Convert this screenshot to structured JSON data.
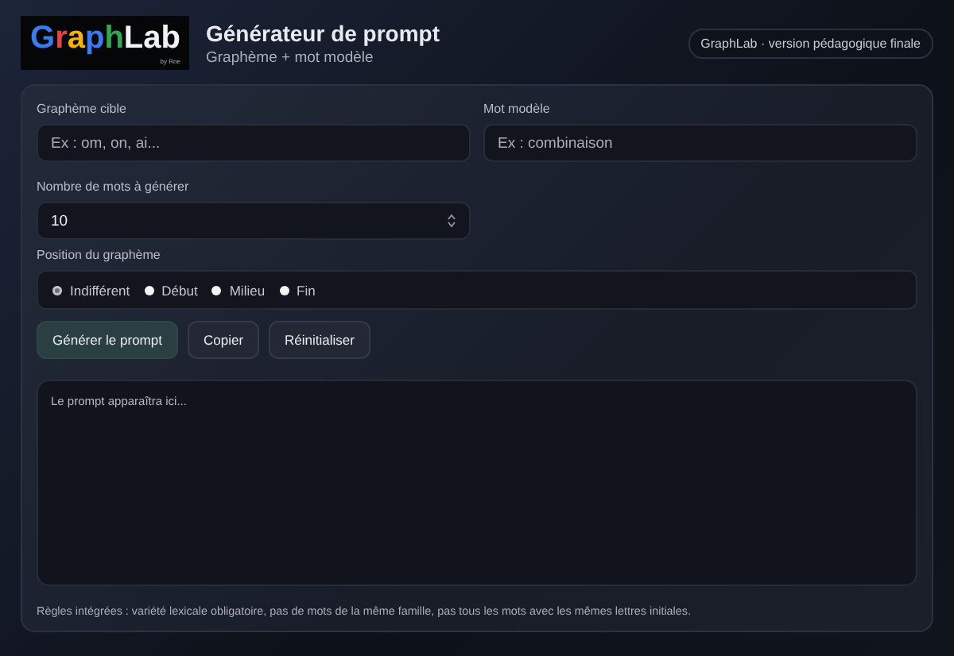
{
  "logo": {
    "text": "GraphLab",
    "byline": "by Rne"
  },
  "header": {
    "title": "Générateur de prompt",
    "subtitle": "Graphème + mot modèle",
    "badge": "GraphLab · version pédagogique finale"
  },
  "fields": [
    {
      "label": "Graphème cible",
      "placeholder": "Ex : om, on, ai..."
    },
    {
      "label": "Mot modèle",
      "placeholder": "Ex : combinaison"
    }
  ],
  "count": {
    "label": "Nombre de mots à générer",
    "value": "10"
  },
  "position": {
    "label": "Position du graphème",
    "options": [
      {
        "label": "Indifférent",
        "selected": true
      },
      {
        "label": "Début",
        "selected": false
      },
      {
        "label": "Milieu",
        "selected": false
      },
      {
        "label": "Fin",
        "selected": false
      }
    ]
  },
  "buttons": [
    {
      "label": "Générer le prompt",
      "kind": "primary"
    },
    {
      "label": "Copier",
      "kind": "secondary"
    },
    {
      "label": "Réinitialiser",
      "kind": "secondary"
    }
  ],
  "output": {
    "placeholder": "Le prompt apparaîtra ici..."
  },
  "footer": "Règles intégrées : variété lexicale obligatoire, pas de mots de la même famille, pas tous les mots avec les mêmes lettres initiales."
}
